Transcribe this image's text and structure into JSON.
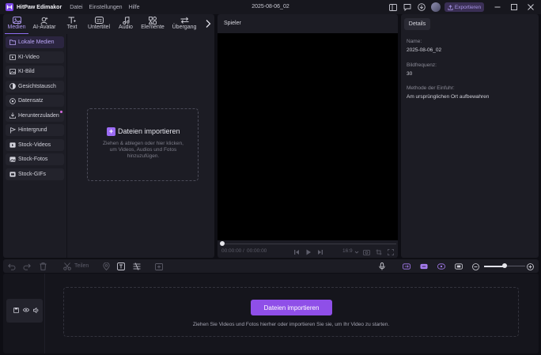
{
  "titlebar": {
    "app_name": "HitPaw Edimakor",
    "menu": [
      "Datei",
      "Einstellungen",
      "Hilfe"
    ],
    "project_title": "2025-08-06_02",
    "export_label": "Exportieren",
    "accent_color": "#8d6cf0"
  },
  "media_tabs": [
    {
      "label": "Medien",
      "icon": "media-icon",
      "active": true
    },
    {
      "label": "AI-Avatar",
      "icon": "avatar-icon"
    },
    {
      "label": "Text",
      "icon": "text-icon"
    },
    {
      "label": "Untertitel",
      "icon": "subtitle-icon"
    },
    {
      "label": "Audio",
      "icon": "audio-icon"
    },
    {
      "label": "Elemente",
      "icon": "elements-icon"
    },
    {
      "label": "Übergang",
      "icon": "transition-icon"
    }
  ],
  "categories": [
    {
      "label": "Lokale Medien",
      "icon": "folder-icon",
      "active": true
    },
    {
      "label": "KI-Video",
      "icon": "video-icon"
    },
    {
      "label": "KI-Bild",
      "icon": "image-icon"
    },
    {
      "label": "Gesichtstausch",
      "icon": "face-icon"
    },
    {
      "label": "Datensatz",
      "icon": "dataset-icon"
    },
    {
      "label": "Herunterzuladen",
      "icon": "download-icon",
      "badge": true
    },
    {
      "label": "Hintergrund",
      "icon": "background-icon"
    },
    {
      "label": "Stock-Videos",
      "icon": "stock-video-icon"
    },
    {
      "label": "Stock-Fotos",
      "icon": "stock-photo-icon"
    },
    {
      "label": "Stock-GIFs",
      "icon": "gif-icon"
    }
  ],
  "import_zone": {
    "title": "Dateien importieren",
    "hint": "Ziehen & ablegen oder hier klicken, um Videos, Audios und Fotos hinzuzufügen."
  },
  "player": {
    "label": "Spieler",
    "time_current": "00:00:00",
    "time_separator": "/",
    "time_total": "00:00:00",
    "aspect_ratio": "16:9"
  },
  "details": {
    "tab": "Details",
    "name_label": "Name:",
    "name_value": "2025-08-06_02",
    "fps_label": "Bildfrequenz:",
    "fps_value": "30",
    "insert_label": "Methode der Einfuhr:",
    "insert_value": "Am ursprünglichen Ort aufbewahren"
  },
  "timeline": {
    "split_label": "Teilen",
    "import_button": "Dateien importieren",
    "hint": "Ziehen Sie Videos und Fotos hierher oder importieren Sie sie, um Ihr Video zu starten.",
    "zoom_level": 0.5
  }
}
